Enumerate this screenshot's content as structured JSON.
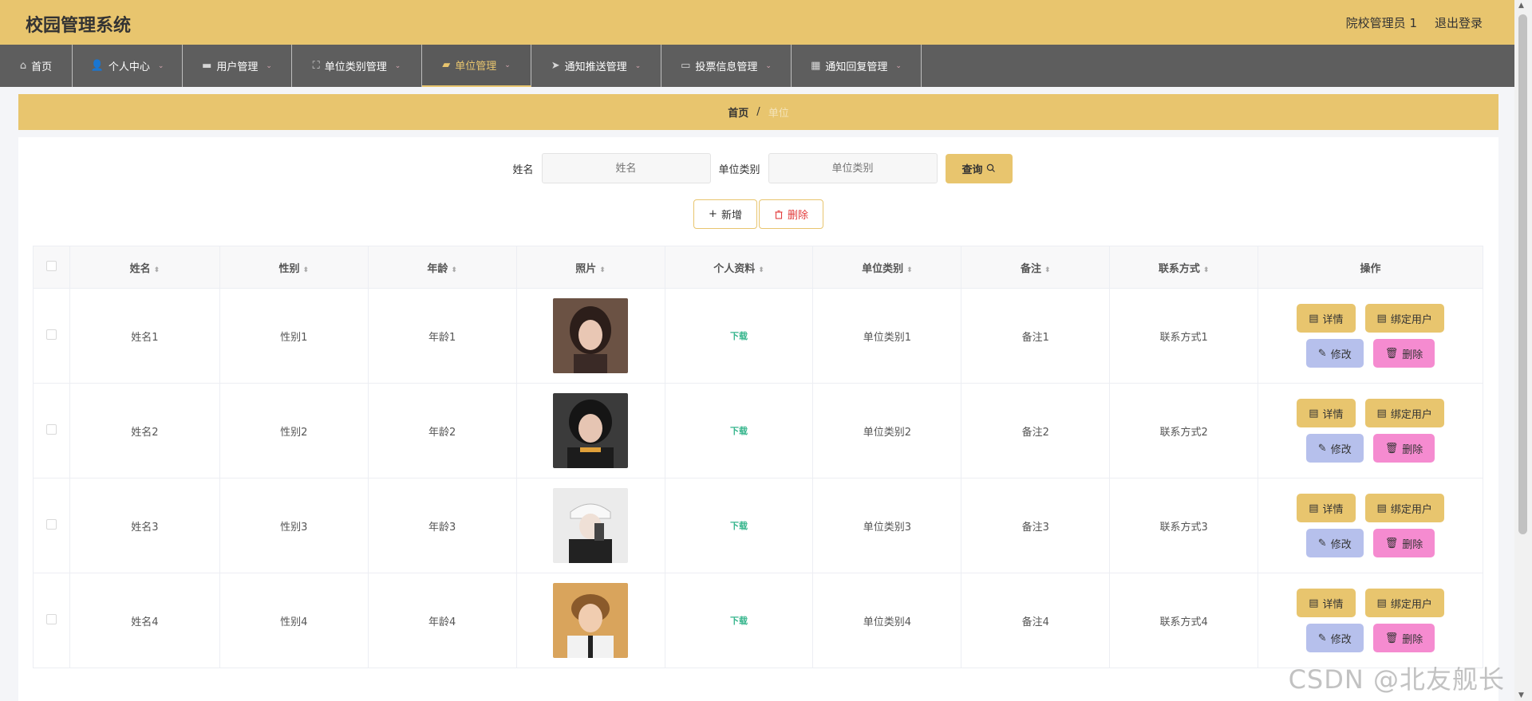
{
  "header": {
    "title": "校园管理系统",
    "user": "院校管理员 1",
    "logout": "退出登录"
  },
  "nav": [
    {
      "label": "首页",
      "icon": "⌂"
    },
    {
      "label": "个人中心",
      "icon": "👤",
      "chev": "⌄"
    },
    {
      "label": "用户管理",
      "icon": "▬",
      "chev": "⌄"
    },
    {
      "label": "单位类别管理",
      "icon": "⛶",
      "chev": "⌄"
    },
    {
      "label": "单位管理",
      "icon": "▰",
      "chev": "⌄"
    },
    {
      "label": "通知推送管理",
      "icon": "➤",
      "chev": "⌄"
    },
    {
      "label": "投票信息管理",
      "icon": "▭",
      "chev": "⌄"
    },
    {
      "label": "通知回复管理",
      "icon": "▦",
      "chev": "⌄"
    }
  ],
  "breadcrumb": {
    "home": "首页",
    "sep": "/",
    "current": "单位"
  },
  "search": {
    "name_label": "姓名",
    "name_placeholder": "姓名",
    "cat_label": "单位类别",
    "cat_placeholder": "单位类别",
    "query": "查询"
  },
  "actions": {
    "add": "新增",
    "delete": "删除"
  },
  "table": {
    "headers": [
      "姓名",
      "性别",
      "年龄",
      "照片",
      "个人资料",
      "单位类别",
      "备注",
      "联系方式",
      "操作"
    ],
    "rows": [
      {
        "name": "姓名1",
        "gender": "性别1",
        "age": "年龄1",
        "file": "下载",
        "category": "单位类别1",
        "note": "备注1",
        "contact": "联系方式1"
      },
      {
        "name": "姓名2",
        "gender": "性别2",
        "age": "年龄2",
        "file": "下载",
        "category": "单位类别2",
        "note": "备注2",
        "contact": "联系方式2"
      },
      {
        "name": "姓名3",
        "gender": "性别3",
        "age": "年龄3",
        "file": "下载",
        "category": "单位类别3",
        "note": "备注3",
        "contact": "联系方式3"
      },
      {
        "name": "姓名4",
        "gender": "性别4",
        "age": "年龄4",
        "file": "下载",
        "category": "单位类别4",
        "note": "备注4",
        "contact": "联系方式4"
      }
    ],
    "ops": {
      "detail": "详情",
      "bind": "绑定用户",
      "edit": "修改",
      "delete": "删除"
    }
  },
  "watermark": "CSDN @北友舰长",
  "colors": {
    "accent": "#e8c56e",
    "nav_bg": "#5e5e5e",
    "edit": "#b6c0ec",
    "delete": "#f58bd0",
    "download": "#35b58c"
  }
}
